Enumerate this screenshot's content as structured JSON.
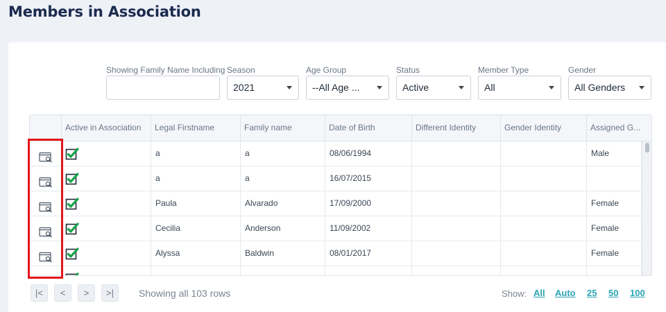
{
  "page": {
    "title": "Members in Association"
  },
  "filters": {
    "family_name": {
      "label": "Showing Family Name Including",
      "value": ""
    },
    "season": {
      "label": "Season",
      "value": "2021"
    },
    "age_group": {
      "label": "Age Group",
      "value": "--All Age ..."
    },
    "status": {
      "label": "Status",
      "value": "Active"
    },
    "member_type": {
      "label": "Member Type",
      "value": "All"
    },
    "gender": {
      "label": "Gender",
      "value": "All Genders"
    }
  },
  "table": {
    "columns": [
      "",
      "Active in Association",
      "Legal Firstname",
      "Family name",
      "Date of Birth",
      "Different Identity",
      "Gender Identity",
      "Assigned G..."
    ],
    "rows": [
      {
        "firstname": "a",
        "family": "a",
        "dob": "08/06/1994",
        "assigned": "Male"
      },
      {
        "firstname": "a",
        "family": "a",
        "dob": "16/07/2015",
        "assigned": ""
      },
      {
        "firstname": "Paula",
        "family": "Alvarado",
        "dob": "17/09/2000",
        "assigned": "Female"
      },
      {
        "firstname": "Cecilia",
        "family": "Anderson",
        "dob": "11/09/2002",
        "assigned": "Female"
      },
      {
        "firstname": "Alyssa",
        "family": "Baldwin",
        "dob": "08/01/2017",
        "assigned": "Female"
      },
      {
        "firstname": "",
        "family": "",
        "dob": "",
        "assigned": ""
      }
    ],
    "row_icons": {
      "view": "view-record-icon",
      "active": "green-check-icon"
    }
  },
  "pager": {
    "first": "|<",
    "prev": "<",
    "next": ">",
    "last": ">|",
    "info": "Showing all 103 rows",
    "show_label": "Show:",
    "options": [
      "All",
      "Auto",
      "25",
      "50",
      "100"
    ]
  },
  "colors": {
    "accent_link": "#2aa4b4",
    "check_green": "#16a34a",
    "highlight_red": "#e3161b",
    "title": "#1b2a4e"
  }
}
